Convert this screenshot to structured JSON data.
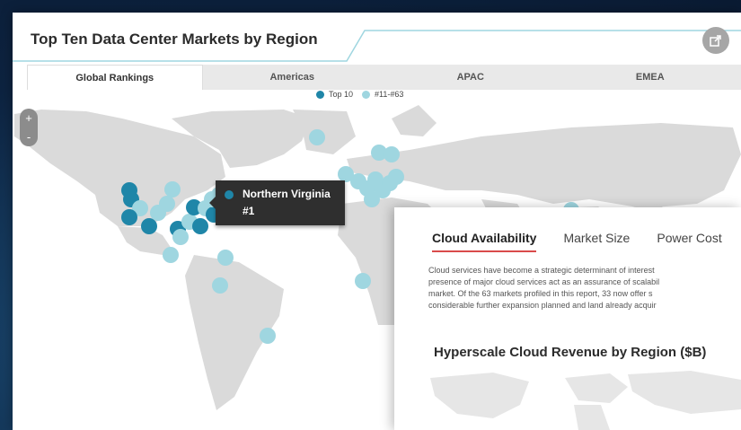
{
  "panel": {
    "title": "Top Ten Data Center Markets by Region",
    "share_icon": "share-icon"
  },
  "tabs": [
    {
      "label": "Global Rankings",
      "active": true
    },
    {
      "label": "Americas",
      "active": false
    },
    {
      "label": "APAC",
      "active": false
    },
    {
      "label": "EMEA",
      "active": false
    }
  ],
  "legend": [
    {
      "label": "Top 10",
      "color": "#1f86a8"
    },
    {
      "label": "#11-#63",
      "color": "#9fd6e0"
    }
  ],
  "zoom": {
    "plus": "+",
    "minus": "-"
  },
  "tooltip": {
    "name": "Northern Virginia",
    "rank": "#1"
  },
  "card": {
    "tabs": [
      {
        "label": "Cloud Availability",
        "active": true
      },
      {
        "label": "Market Size",
        "active": false
      },
      {
        "label": "Power Cost",
        "active": false
      }
    ],
    "text_lines": [
      "Cloud services have become a strategic determinant of interest",
      "presence of major cloud services act as an assurance of scalabil",
      "market. Of the 63 markets profiled in this report, 33 now offer s",
      "considerable further expansion planned and land already acquir"
    ],
    "heading": "Hyperscale Cloud Revenue by Region ($B)"
  },
  "colors": {
    "top10": "#1f86a8",
    "others": "#9fd6e0",
    "land": "#dadada",
    "accent_underline": "#d94b4b"
  }
}
